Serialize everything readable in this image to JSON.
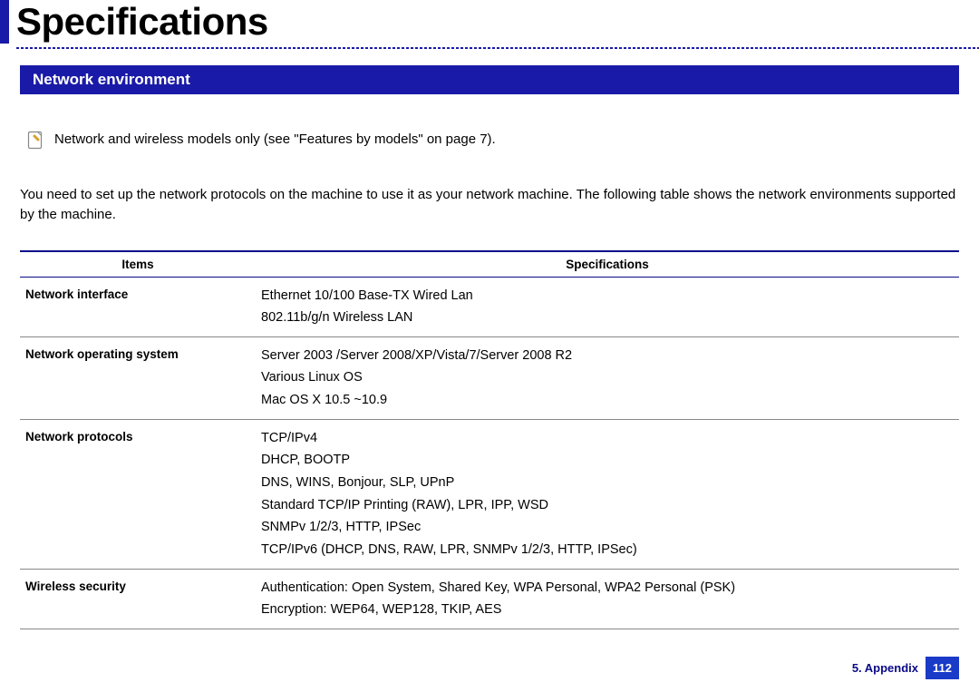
{
  "page_title": "Specifications",
  "section_heading": "Network environment",
  "note_text": "Network and wireless models only (see \"Features by models\" on page 7).",
  "intro_paragraph": "You need to set up the network protocols on the machine to use it as your network machine. The following table shows the network environments supported by the machine.",
  "table": {
    "headers": {
      "items": "Items",
      "spec": "Specifications"
    },
    "rows": [
      {
        "item": "Network interface",
        "lines": [
          "Ethernet 10/100 Base-TX Wired Lan",
          "802.11b/g/n Wireless LAN"
        ]
      },
      {
        "item": "Network operating system",
        "lines": [
          "Server 2003 /Server 2008/XP/Vista/7/Server 2008 R2",
          "Various Linux OS",
          "Mac OS X 10.5 ~10.9"
        ]
      },
      {
        "item": "Network protocols",
        "lines": [
          "TCP/IPv4",
          "DHCP, BOOTP",
          "DNS, WINS, Bonjour, SLP, UPnP",
          "Standard TCP/IP Printing (RAW), LPR, IPP, WSD",
          "SNMPv 1/2/3, HTTP, IPSec",
          "TCP/IPv6 (DHCP, DNS, RAW, LPR, SNMPv 1/2/3, HTTP, IPSec)"
        ]
      },
      {
        "item": "Wireless security",
        "lines": [
          "Authentication: Open System, Shared Key, WPA Personal, WPA2 Personal (PSK)",
          "Encryption: WEP64, WEP128, TKIP, AES"
        ]
      }
    ]
  },
  "footer": {
    "chapter": "5. Appendix",
    "page": "112"
  }
}
